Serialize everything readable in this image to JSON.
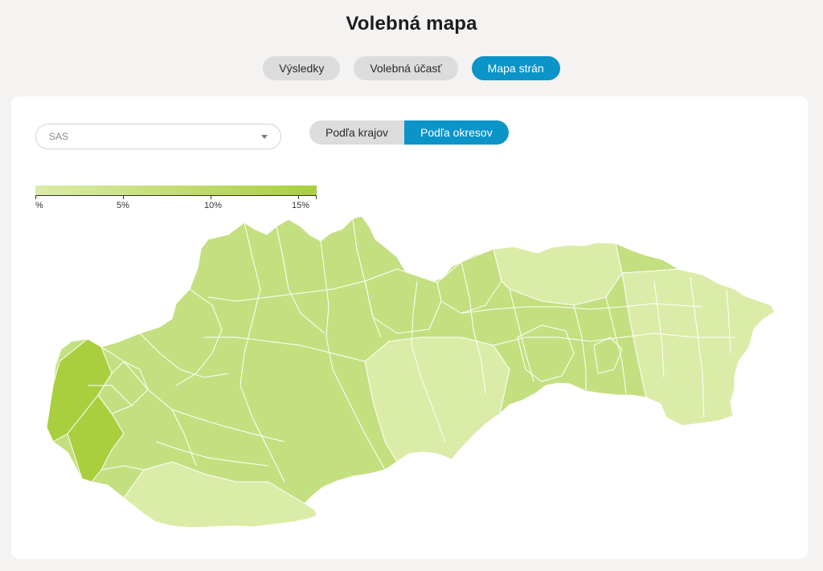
{
  "page": {
    "title": "Volebná mapa"
  },
  "main_tabs": [
    {
      "label": "Výsledky",
      "active": false
    },
    {
      "label": "Volebná účasť",
      "active": false
    },
    {
      "label": "Mapa strán",
      "active": true
    }
  ],
  "filters": {
    "party_select": {
      "value": "SAS",
      "icon": "chevron-down-icon"
    },
    "view_toggle": [
      {
        "label": "Podľa krajov",
        "active": false
      },
      {
        "label": "Podľa okresov",
        "active": true
      }
    ]
  },
  "legend": {
    "ticks": [
      {
        "label": "%",
        "value": 0
      },
      {
        "label": "5%",
        "value": 5
      },
      {
        "label": "10%",
        "value": 10
      },
      {
        "label": "15%",
        "value": 15
      }
    ],
    "max_value": 16,
    "colors": {
      "low": "#dbeca8",
      "high": "#a9cf3e"
    }
  },
  "colors": {
    "accent": "#0b94c8",
    "map_low": "#dbeca8",
    "map_mid": "#c4df80",
    "map_high": "#a9cf3e",
    "map_border": "#ffffff"
  }
}
